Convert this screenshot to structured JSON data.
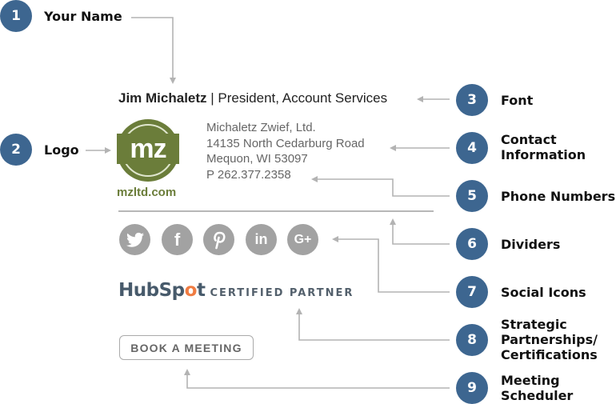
{
  "callouts": [
    {
      "number": "1",
      "label_lines": [
        "Your Name"
      ]
    },
    {
      "number": "2",
      "label_lines": [
        "Logo"
      ]
    },
    {
      "number": "3",
      "label_lines": [
        "Font"
      ]
    },
    {
      "number": "4",
      "label_lines": [
        "Contact",
        "Information"
      ]
    },
    {
      "number": "5",
      "label_lines": [
        "Phone Numbers"
      ]
    },
    {
      "number": "6",
      "label_lines": [
        "Dividers"
      ]
    },
    {
      "number": "7",
      "label_lines": [
        "Social Icons"
      ]
    },
    {
      "number": "8",
      "label_lines": [
        "Strategic",
        "Partnerships/",
        "Certifications"
      ]
    },
    {
      "number": "9",
      "label_lines": [
        "Meeting",
        "Scheduler"
      ]
    }
  ],
  "signature": {
    "name": "Jim Michaletz",
    "separator": " | ",
    "title": "President, Account Services",
    "logo": {
      "monogram": "mz",
      "url_text": "mzltd.com",
      "color": "#6b7d3a"
    },
    "contact_lines": [
      "Michaletz Zwief, Ltd.",
      "14135 North Cedarburg Road",
      "Mequon, WI 53097",
      "P 262.377.2358"
    ],
    "social_icons": [
      {
        "name": "twitter-icon",
        "glyph": "🐦"
      },
      {
        "name": "facebook-icon",
        "glyph": "f"
      },
      {
        "name": "pinterest-icon",
        "glyph": "P"
      },
      {
        "name": "linkedin-icon",
        "glyph": "in"
      },
      {
        "name": "google-plus-icon",
        "glyph": "G+"
      }
    ],
    "partner": {
      "brand_pre": "HubSp",
      "brand_o": "o",
      "brand_post": "t",
      "text": "CERTIFIED PARTNER",
      "accent": "#f07c42"
    },
    "meeting_button": "BOOK A MEETING"
  },
  "colors": {
    "badge": "#3d6690",
    "connector": "#b3b3b3",
    "social": "#a2a2a2"
  }
}
